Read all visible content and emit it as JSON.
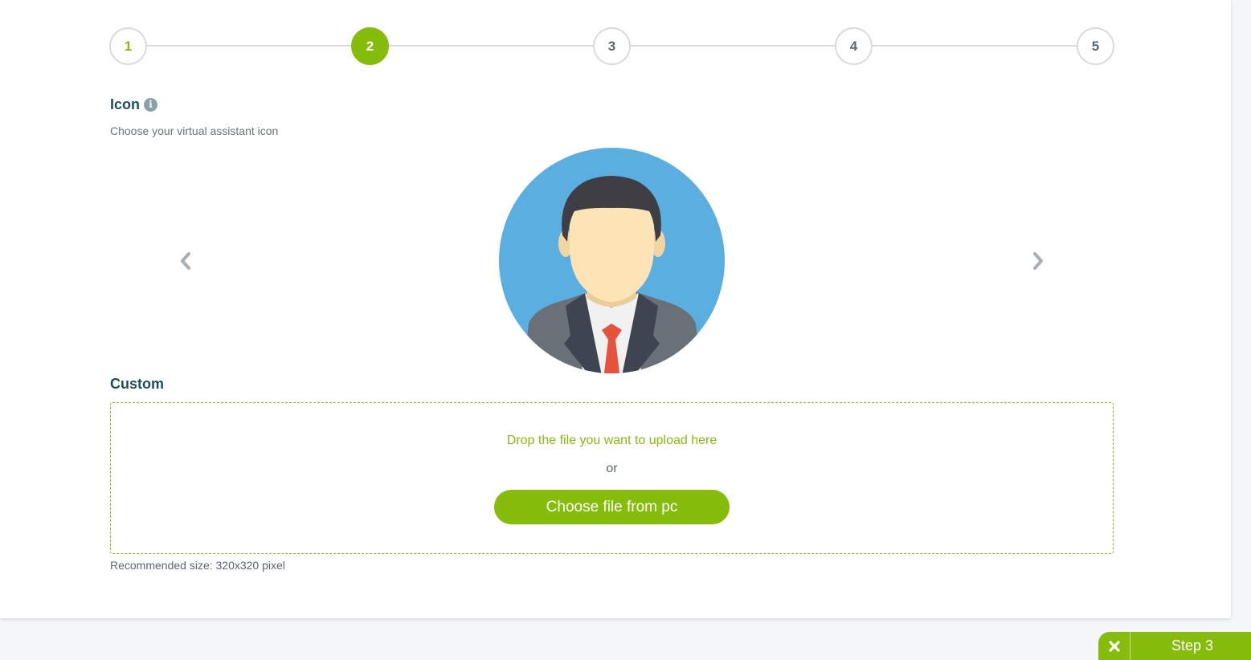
{
  "stepper": {
    "steps": [
      {
        "label": "1",
        "state": "done"
      },
      {
        "label": "2",
        "state": "active"
      },
      {
        "label": "3",
        "state": "upcoming"
      },
      {
        "label": "4",
        "state": "upcoming"
      },
      {
        "label": "5",
        "state": "upcoming"
      }
    ]
  },
  "icon_section": {
    "title": "Icon",
    "info_icon": "info-icon",
    "subtitle": "Choose your virtual assistant icon",
    "prev_icon": "chevron-left-icon",
    "next_icon": "chevron-right-icon",
    "selected_avatar": "businessman-avatar"
  },
  "custom_section": {
    "title": "Custom",
    "drop_text": "Drop the file you want to upload here",
    "or_text": "or",
    "choose_button": "Choose file from pc",
    "recommended": "Recommended size: 320x320 pixel"
  },
  "bottom_bar": {
    "close_icon": "close-icon",
    "next_label": "Step 3"
  },
  "colors": {
    "accent": "#86bc0c",
    "title": "#1f4d5c",
    "avatar_bg": "#5aafe0"
  }
}
